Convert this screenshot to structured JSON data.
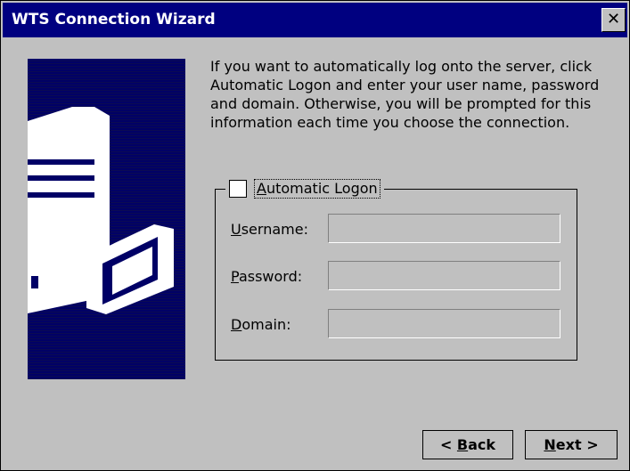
{
  "window": {
    "title": "WTS Connection Wizard",
    "close_label": "✕"
  },
  "description": "If you want to automatically log onto the server, click Automatic Logon and enter your user name, password and domain. Otherwise, you will be prompted for this information each time you choose the connection.",
  "auto_logon": {
    "checked": false,
    "label_first": "A",
    "label_rest": "utomatic Logon"
  },
  "fields": {
    "username": {
      "label_first": "U",
      "label_rest": "sername:",
      "value": ""
    },
    "password": {
      "label_first": "P",
      "label_rest": "assword:",
      "value": ""
    },
    "domain": {
      "label_first": "D",
      "label_rest": "omain:",
      "value": ""
    }
  },
  "buttons": {
    "back": {
      "prefix": "< ",
      "key": "B",
      "rest": "ack"
    },
    "next": {
      "key": "N",
      "rest": "ext >"
    }
  },
  "colors": {
    "titlebar": "#000080",
    "art_background": "#000066",
    "face": "#c0c0c0"
  },
  "icons": {
    "art": "server-and-monitor-illustration",
    "close": "close-icon"
  }
}
